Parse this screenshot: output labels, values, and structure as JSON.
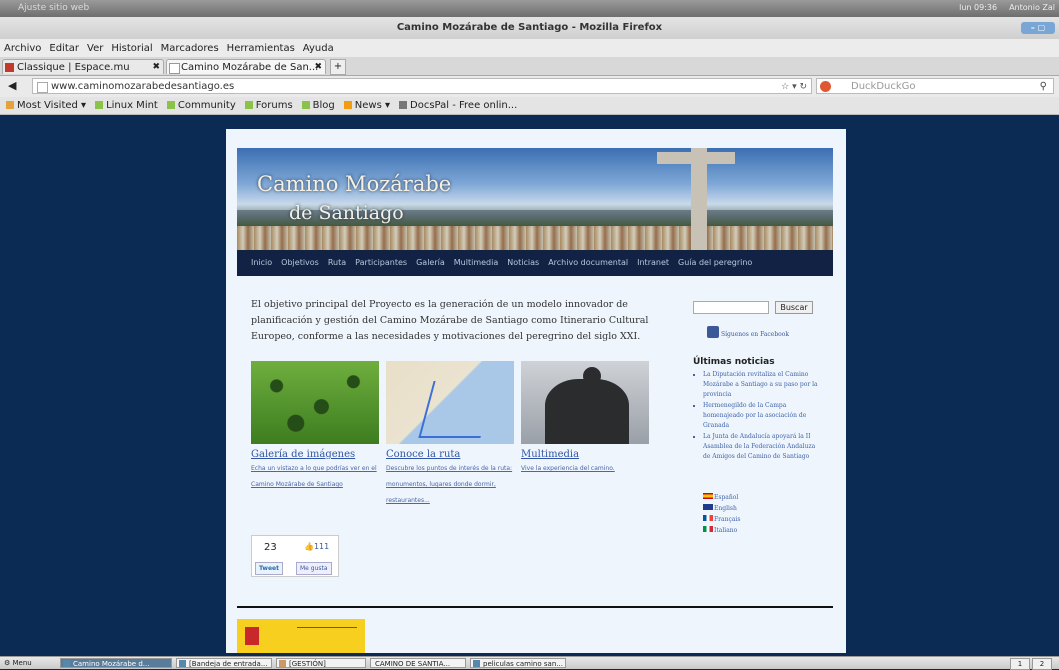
{
  "topbar": {
    "app": "Ajuste sitio web",
    "clock": "lun 09:36",
    "user": "Antonio Zal"
  },
  "window": {
    "title": "Camino Mozárabe de Santiago - Mozilla Firefox"
  },
  "menu": [
    "Archivo",
    "Editar",
    "Ver",
    "Historial",
    "Marcadores",
    "Herramientas",
    "Ayuda"
  ],
  "tabs": [
    {
      "label": "Classique | Espace.mu",
      "close": "✖"
    },
    {
      "label": "Camino Mozárabe de San...",
      "close": "✖"
    }
  ],
  "new_tab": "+",
  "address": {
    "url": "www.caminomozarabedesantiago.es",
    "search_placeholder": "DuckDuckGo",
    "controls": "☆ ▾ ↻"
  },
  "bookmarks": [
    "Most Visited ▾",
    "Linux Mint",
    "Community",
    "Forums",
    "Blog",
    "News ▾",
    "DocsPal - Free onlin..."
  ],
  "site": {
    "banner": {
      "line1": "Camino  Mozárabe",
      "line2": "de Santiago"
    },
    "nav": [
      "Inicio",
      "Objetivos",
      "Ruta",
      "Participantes",
      "Galería",
      "Multimedia",
      "Noticias",
      "Archivo documental",
      "Intranet",
      "Guía del peregrino"
    ],
    "intro": "El objetivo principal del Proyecto es la generación de un modelo innovador de planificación y gestión del Camino Mozárabe de Santiago como Itinerario Cultural Europeo, conforme a las necesidades y motivaciones del peregrino del siglo XXI.",
    "cards": [
      {
        "title": "Galería de imágenes",
        "desc": "Echa un vistazo a lo que podrías ver en el Camino Mozárabe de Santiago"
      },
      {
        "title": "Conoce la ruta",
        "desc": "Descubre los puntos de interés de la ruta: monumentos, lugares donde dormir, restaurantes..."
      },
      {
        "title": "Multimedia",
        "desc": "Vive la experiencia del camino."
      }
    ],
    "social": {
      "count": "23",
      "likes": "111",
      "tweet": "Tweet",
      "fb_like": "Me gusta"
    },
    "search_button": "Buscar",
    "facebook_follow": "Síguenos en Facebook",
    "news_heading": "Últimas noticias",
    "news": [
      "La Diputación revitaliza el Camino Mozárabe a Santiago a su paso por la provincia",
      "Hermenegildo de la Campa homenajeado por la asociación de Granada",
      "La Junta de Andalucía apoyará la II Asamblea de la Federación Andaluza de Amigos del Camino de Santiago"
    ],
    "languages": [
      "Español",
      "English",
      "Français",
      "Italiano"
    ]
  },
  "taskbar": {
    "menu": "Menu",
    "items": [
      "Camino Mozárabe d...",
      "[Bandeja de entrada...",
      "[GESTIÓN]",
      "CAMINO DE SANTIA...",
      "peliculas camino san..."
    ],
    "workspaces": [
      "1",
      "2"
    ]
  },
  "colors": {
    "page_bg": "#0b2b55",
    "site_bg": "#eef5fd",
    "link": "#3155a6",
    "nav_bg": "#112244"
  }
}
